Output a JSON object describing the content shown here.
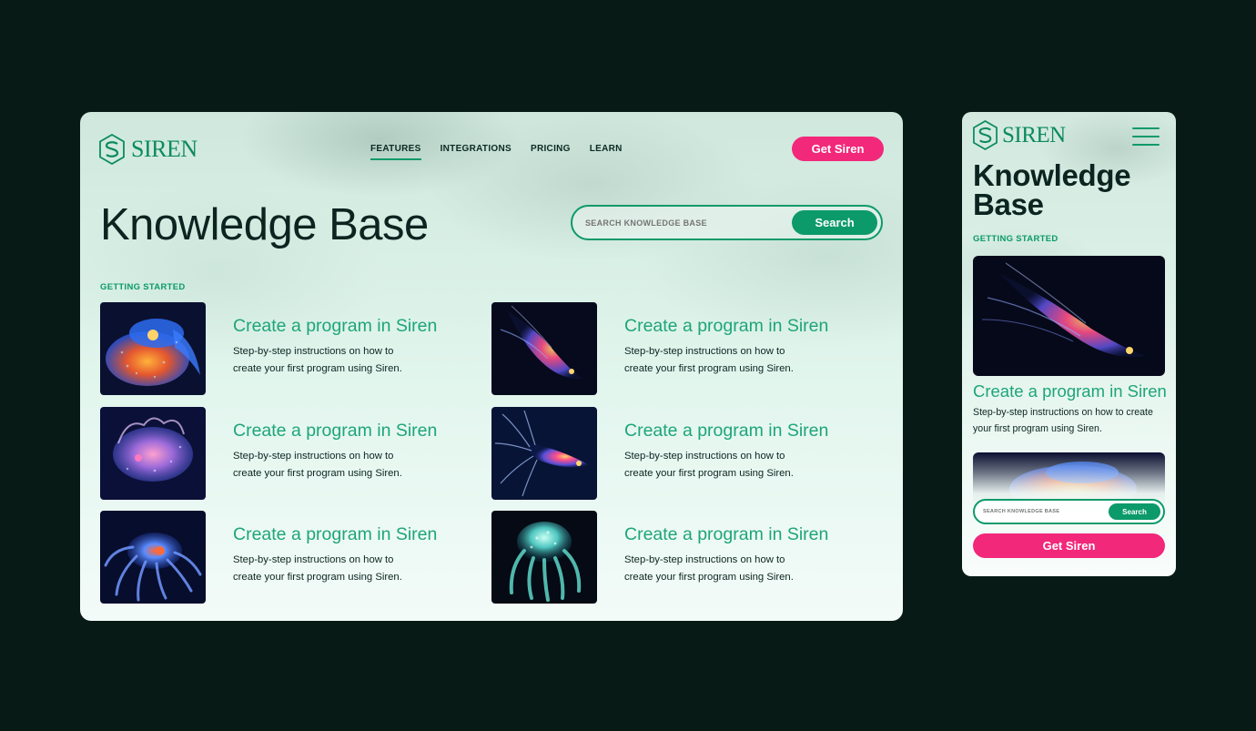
{
  "brand": {
    "name": "SIREN",
    "primary": "#0c9a6a",
    "accent": "#f2287a",
    "background": "#081a15"
  },
  "desktop": {
    "nav": [
      {
        "label": "FEATURES",
        "active": true
      },
      {
        "label": "INTEGRATIONS",
        "active": false
      },
      {
        "label": "PRICING",
        "active": false
      },
      {
        "label": "LEARN",
        "active": false
      }
    ],
    "cta_label": "Get Siren",
    "page_title": "Knowledge Base",
    "search": {
      "placeholder": "SEARCH KNOWLEDGE BASE",
      "button_label": "Search"
    },
    "section_label": "GETTING STARTED",
    "articles": [
      {
        "title": "Create a program in Siren",
        "description": "Step-by-step instructions on how to create your first program using Siren.",
        "image": "orange-blue-sea-creature"
      },
      {
        "title": "Create a program in Siren",
        "description": "Step-by-step instructions on how to create your first program using Siren.",
        "image": "glowing-squid"
      },
      {
        "title": "Create a program in Siren",
        "description": "Step-by-step instructions on how to create your first program using Siren.",
        "image": "pink-sea-dragon"
      },
      {
        "title": "Create a program in Siren",
        "description": "Step-by-step instructions on how to create your first program using Siren.",
        "image": "tentacled-squid"
      },
      {
        "title": "Create a program in Siren",
        "description": "Step-by-step instructions on how to create your first program using Siren.",
        "image": "blue-jellyfish"
      },
      {
        "title": "Create a program in Siren",
        "description": "Step-by-step instructions on how to create your first program using Siren.",
        "image": "teal-octopus"
      }
    ]
  },
  "mobile": {
    "page_title": "Knowledge Base",
    "section_label": "GETTING STARTED",
    "article": {
      "title": "Create a program in Siren",
      "description": "Step-by-step instructions on how to create your first program using Siren."
    },
    "search": {
      "placeholder": "SEARCH KNOWLEDGE BASE",
      "button_label": "Search"
    },
    "cta_label": "Get Siren",
    "menu_icon": "hamburger-menu-icon"
  }
}
